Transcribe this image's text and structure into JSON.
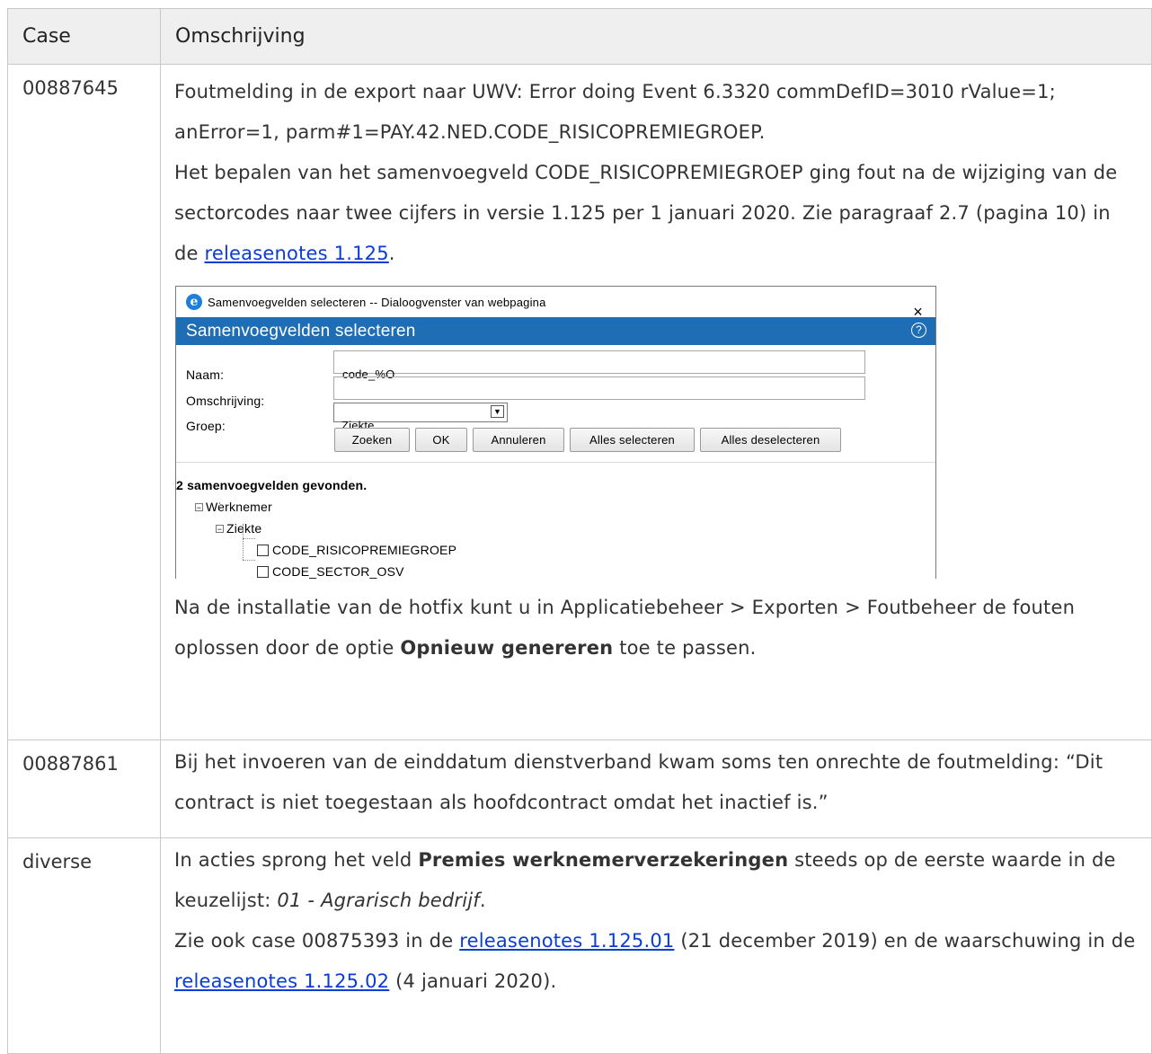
{
  "table": {
    "header": {
      "case": "Case",
      "description": "Omschrijving"
    },
    "row1": {
      "case": "00887645",
      "p1": "Foutmelding in de export naar UWV: Error doing Event 6.3320 commDefID=3010 rValue=1; anError=1, parm#1=PAY.42.NED.CODE_RISICOPREMIEGROEP.",
      "p2_text": "Het bepalen van het samenvoegveld CODE_RISICOPREMIEGROEP ging fout na de wijziging van de sectorcodes naar twee cijfers in versie 1.125 per 1 januari 2020. Zie paragraaf 2.7 (pagina 10) in de ",
      "p2_link": "releasenotes 1.125",
      "p2_end": ".",
      "p3_before": "Na de installatie van de hotfix kunt u in Applicatiebeheer > Exporten > Foutbeheer de fouten oplossen door de optie ",
      "p3_bold": "Opnieuw genereren",
      "p3_after": " toe te passen."
    },
    "row2": {
      "case": "00887861",
      "text": "Bij het invoeren van de einddatum dienstverband kwam soms ten onrechte de foutmelding: “Dit contract is niet toegestaan als hoofdcontract omdat het inactief is.”"
    },
    "row3": {
      "case": "diverse",
      "t1": "In acties sprong het veld ",
      "t1_bold": "Premies werknemerverzekeringen",
      "t1_after": " steeds op de eerste waarde in de keuzelijst: ",
      "t1_italic": "01 - Agrarisch bedrijf",
      "t1_end": ".",
      "t2_before": "Zie ook case 00875393 in de ",
      "t2_link": "releasenotes 1.125.01",
      "t2_after": " (21 december 2019) en de waarschuwing in de ",
      "t2_link2": "releasenotes 1.125.02",
      "t2_end": " (4 januari 2020)."
    }
  },
  "dialog": {
    "window_title": "Samenvoegvelden selecteren -- Dialoogvenster van webpagina",
    "close": "×",
    "header": "Samenvoegvelden selecteren",
    "help": "?",
    "naam_label": "Naam:",
    "naam_value": "code_%O",
    "omschrijving_label": "Omschrijving:",
    "omschrijving_value": "",
    "groep_label": "Groep:",
    "groep_value": "Ziekte",
    "buttons": {
      "zoeken": "Zoeken",
      "ok": "OK",
      "annuleren": "Annuleren",
      "alles_selecteren": "Alles selecteren",
      "alles_deselecteren": "Alles deselecteren"
    },
    "found": "2 samenvoegvelden gevonden.",
    "tree": {
      "root": "Werknemer",
      "group": "Ziekte",
      "item1": "CODE_RISICOPREMIEGROEP",
      "item2": "CODE_SECTOR_OSV"
    }
  },
  "colors": {
    "link": "#0a3cd6",
    "dialog_header": "#1f6eb5",
    "table_header_bg": "#efefef"
  }
}
